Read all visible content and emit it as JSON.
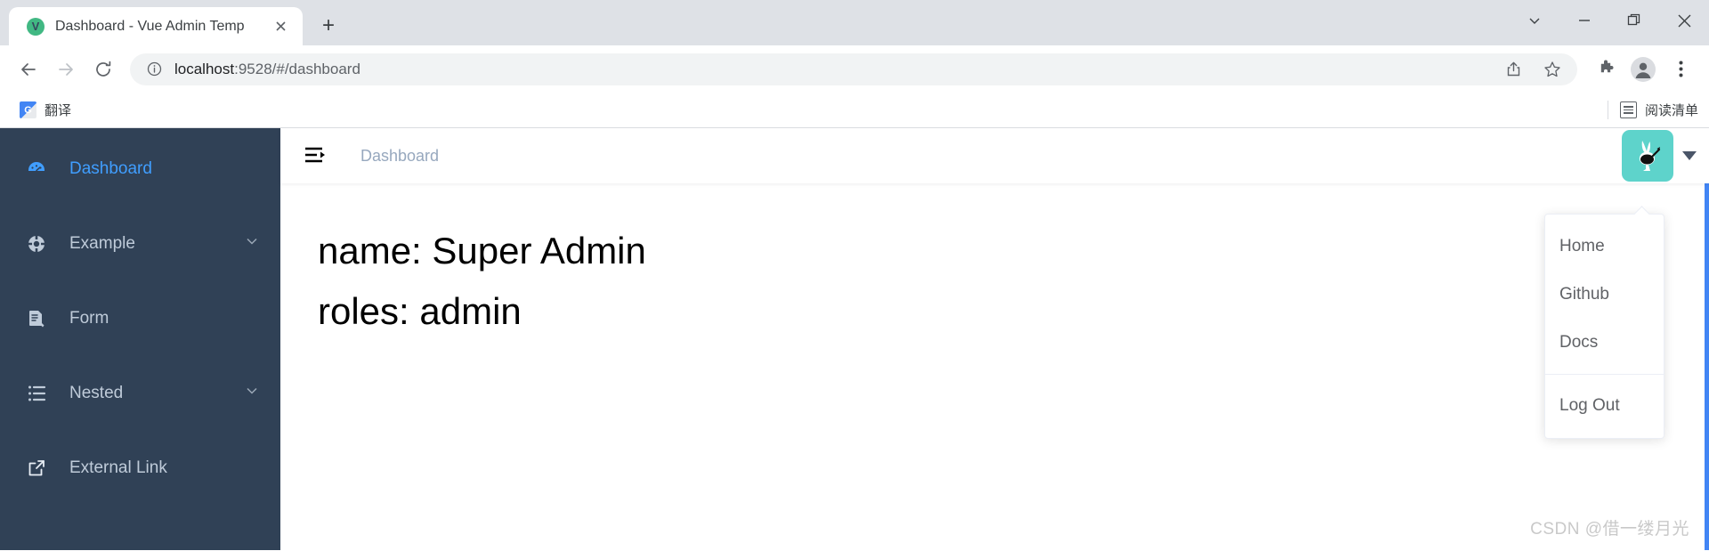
{
  "browser": {
    "tab": {
      "title": "Dashboard - Vue Admin Temp",
      "favicon_letter": "V",
      "favicon_color": "#41b883",
      "close_icon": "close-icon"
    },
    "new_tab_label": "+",
    "window_controls": [
      {
        "name": "tab-search-button",
        "glyph": "⌄"
      },
      {
        "name": "minimize-button",
        "glyph": "—"
      },
      {
        "name": "maximize-button",
        "glyph": "❐"
      },
      {
        "name": "close-window-button",
        "glyph": "✕"
      }
    ],
    "toolbar": {
      "back_label": "←",
      "forward_label": "→",
      "reload_label": "↻",
      "url_host": "localhost",
      "url_rest": ":9528/#/dashboard",
      "info_icon": "info-circle-icon",
      "share_icon": "share-icon",
      "bookmark_icon": "star-icon",
      "extensions_icon": "puzzle-icon",
      "profile_icon": "profile-avatar-icon",
      "menu_icon": "three-dots-menu-icon"
    },
    "bookmarks": {
      "items": [
        {
          "label": "翻译",
          "icon": "google-translate-icon",
          "icon_letter": "G"
        }
      ],
      "reading_list_label": "阅读清单"
    }
  },
  "app": {
    "sidebar": {
      "bg_color": "#304156",
      "active_color": "#409eff",
      "items": [
        {
          "label": "Dashboard",
          "icon": "dashboard-gauge-icon",
          "active": true,
          "expandable": false
        },
        {
          "label": "Example",
          "icon": "component-icon",
          "active": false,
          "expandable": true
        },
        {
          "label": "Form",
          "icon": "form-document-icon",
          "active": false,
          "expandable": false
        },
        {
          "label": "Nested",
          "icon": "nested-list-icon",
          "active": false,
          "expandable": true
        },
        {
          "label": "External Link",
          "icon": "external-link-icon",
          "active": false,
          "expandable": false
        }
      ]
    },
    "navbar": {
      "hamburger_icon": "collapse-sidebar-icon",
      "breadcrumb": "Dashboard",
      "avatar_icon": "rabbit-avatar-icon",
      "avatar_bg": "#5ed3cb",
      "caret_icon": "caret-down-icon"
    },
    "dropdown": {
      "items": [
        {
          "label": "Home"
        },
        {
          "label": "Github"
        },
        {
          "label": "Docs"
        }
      ],
      "logout_label": "Log Out"
    },
    "content": {
      "line1": "name: Super Admin",
      "line2": "roles: admin"
    },
    "watermark": "CSDN @借一缕月光"
  }
}
